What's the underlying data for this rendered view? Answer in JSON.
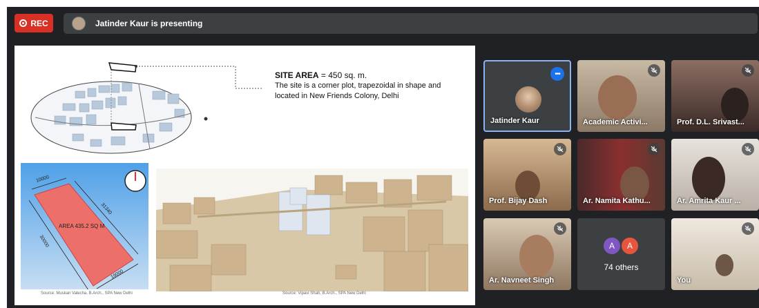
{
  "recording": {
    "label": "REC"
  },
  "presenter_bar": {
    "text": "Jatinder Kaur is presenting"
  },
  "slide": {
    "title_bold": "SITE AREA",
    "title_rest": " = 450 sq. m.",
    "description": "The site is a corner plot, trapezoidal in shape and located in New Friends Colony, Delhi",
    "plot": {
      "area_label": "AREA 435.2 SQ M",
      "dim_top": "10000",
      "dim_right": "31340",
      "dim_left": "30000",
      "dim_bottom": "19000"
    },
    "source_left": "Source: Muskan Valecha, B.Arch., SPA New Delhi",
    "source_right": "Source: Vipavi Shah, B.Arch., SPA New Delhi"
  },
  "participants": [
    {
      "name": "Jatinder Kaur",
      "active": true,
      "muted": false
    },
    {
      "name": "Academic Activi...",
      "muted": true
    },
    {
      "name": "Prof. D.L. Srivast...",
      "muted": true
    },
    {
      "name": "Prof. Bijay Dash",
      "muted": true
    },
    {
      "name": "Ar. Namita Kathu...",
      "muted": true
    },
    {
      "name": "Ar. Amrita Kaur ...",
      "muted": true
    },
    {
      "name": "Ar. Navneet Singh",
      "muted": true
    },
    {
      "name": "You",
      "muted": true
    }
  ],
  "others": {
    "label": "74 others",
    "avatars": [
      {
        "letter": "A",
        "color": "#7e57c2"
      },
      {
        "letter": "A",
        "color": "#e8553f"
      }
    ]
  },
  "icons": {
    "more": "more-horizontal-icon",
    "mute": "mic-off-icon",
    "rec": "record-icon"
  },
  "colors": {
    "accent": "#1a73e8",
    "rec": "#d93025",
    "background": "#202124"
  }
}
